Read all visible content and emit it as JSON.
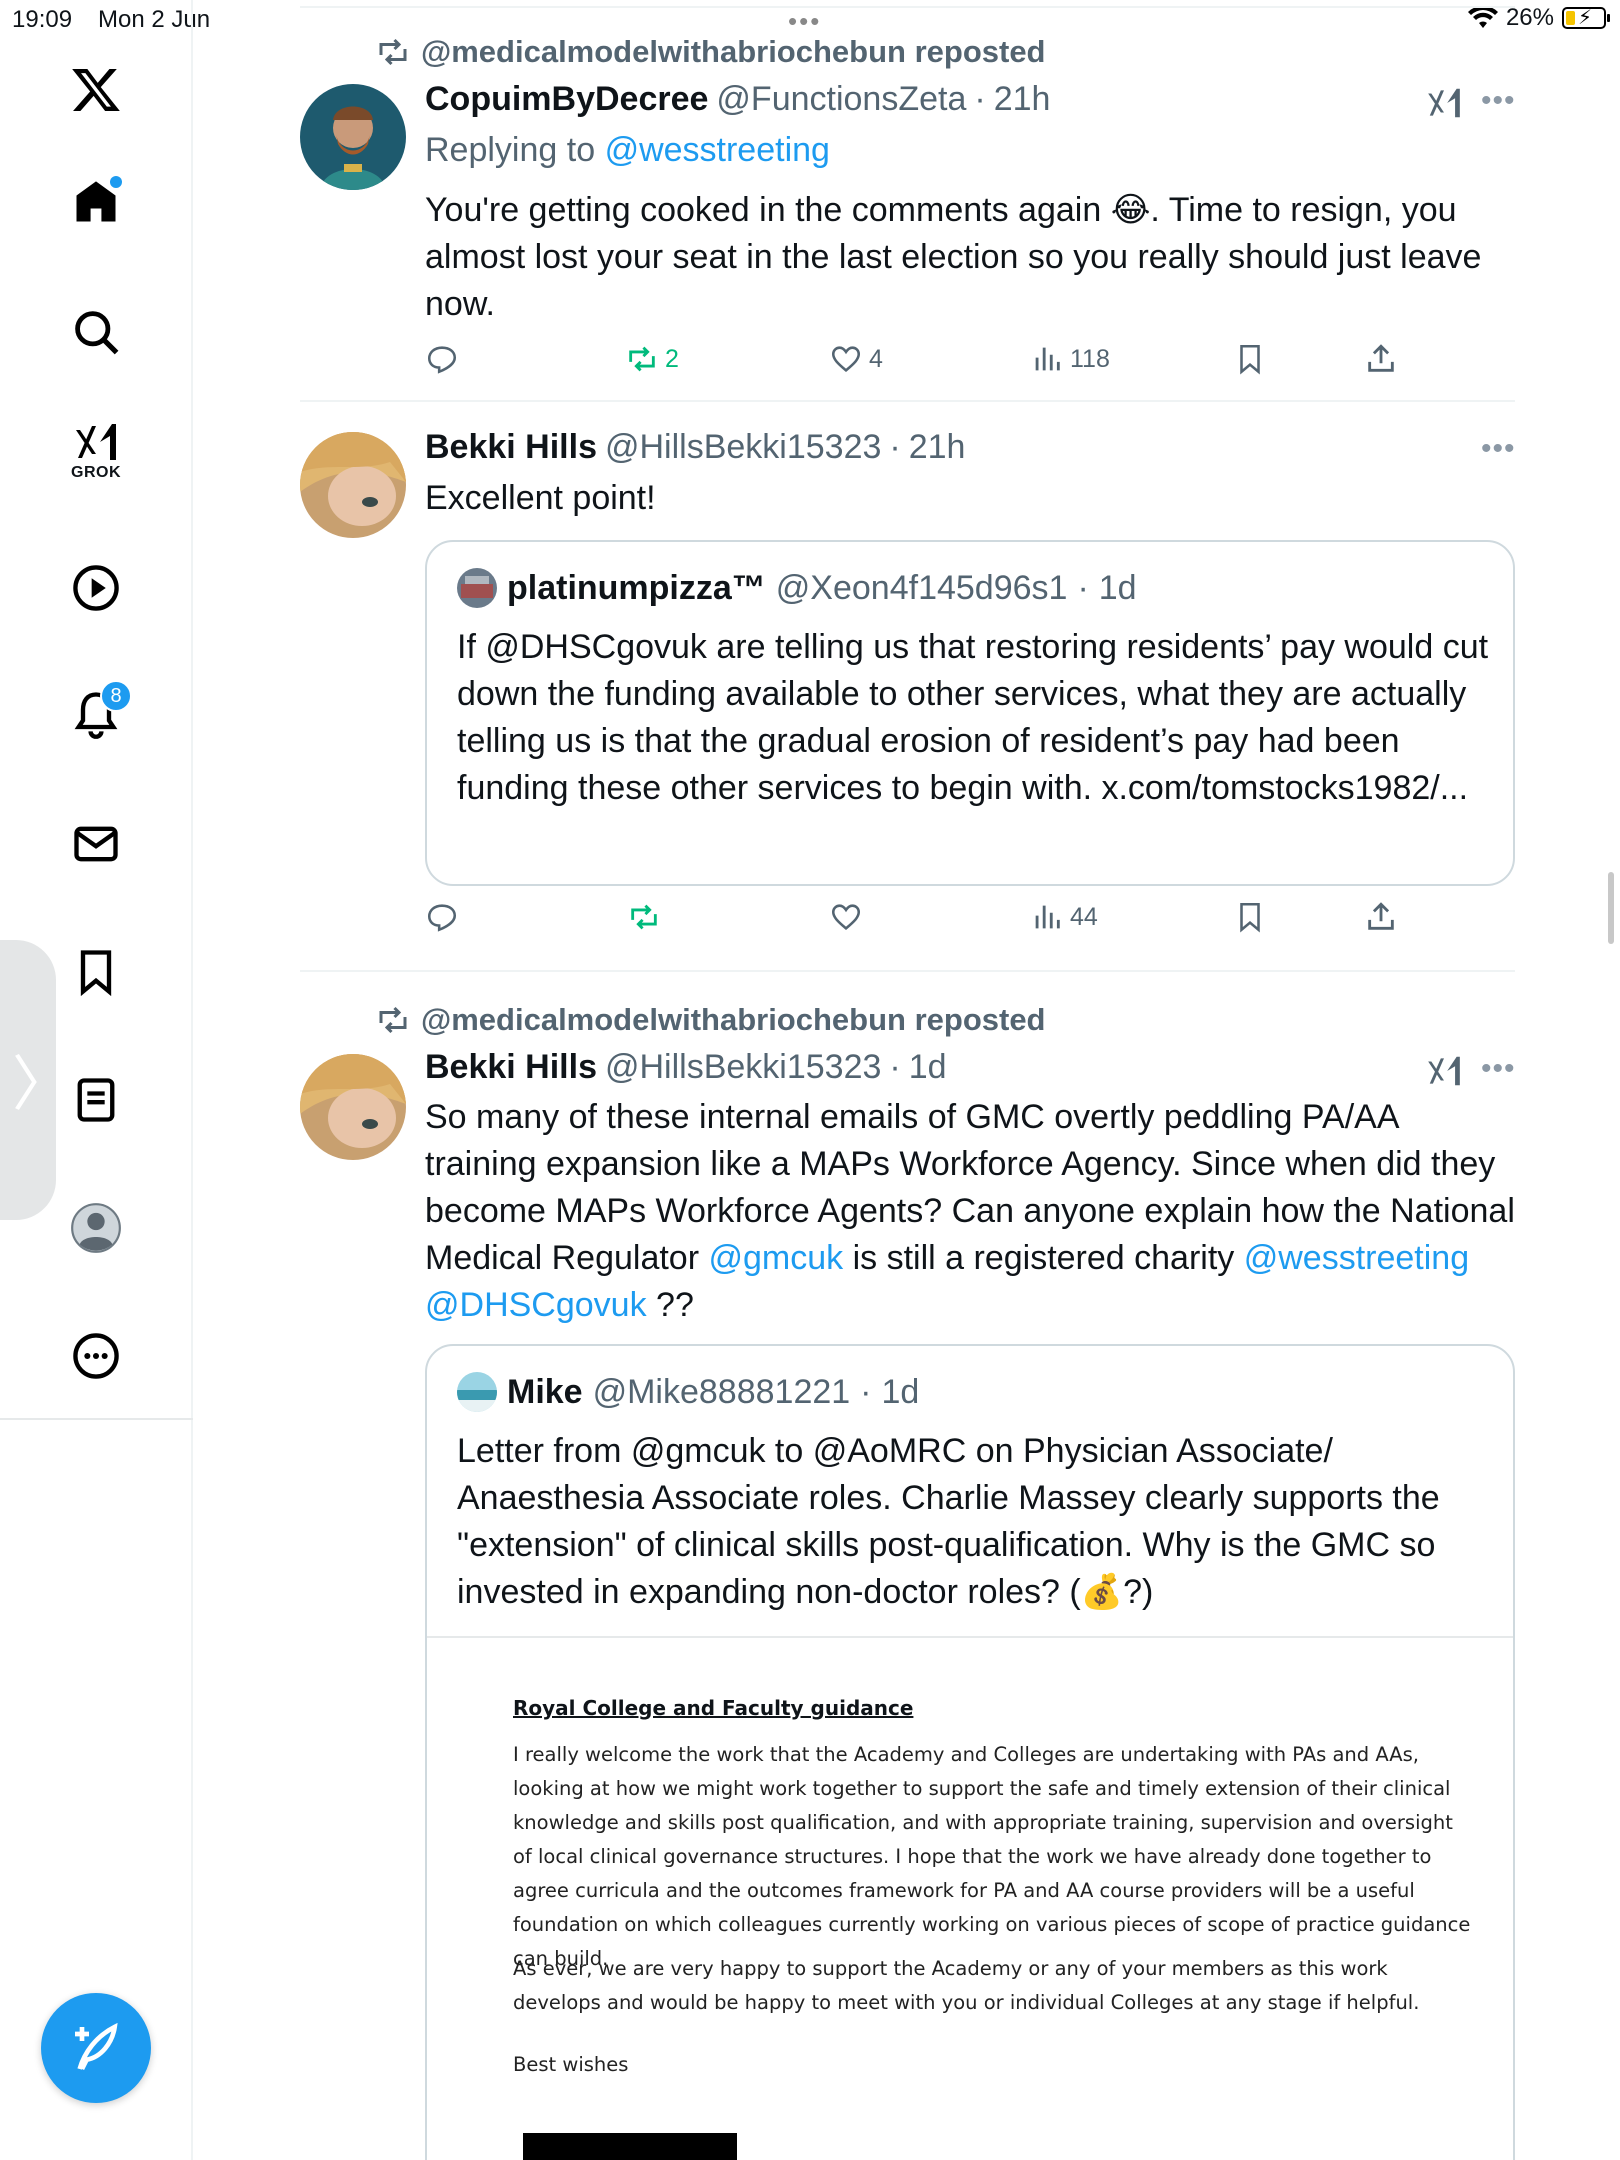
{
  "status_bar": {
    "time": "19:09",
    "date": "Mon 2 Jun",
    "battery": "26%",
    "battery_level": 0.26
  },
  "sidebar": {
    "items": [
      {
        "name": "x-logo",
        "label": ""
      },
      {
        "name": "home",
        "label": ""
      },
      {
        "name": "search",
        "label": ""
      },
      {
        "name": "grok",
        "label": "GROK"
      },
      {
        "name": "videos",
        "label": ""
      },
      {
        "name": "notifications",
        "label": "",
        "badge": "8"
      },
      {
        "name": "messages",
        "label": ""
      },
      {
        "name": "bookmarks",
        "label": ""
      },
      {
        "name": "lists",
        "label": ""
      },
      {
        "name": "profile",
        "label": ""
      },
      {
        "name": "more",
        "label": ""
      }
    ],
    "grok_label": "GROK",
    "notification_badge": "8"
  },
  "tweets": [
    {
      "repost_text": "@medicalmodelwithabriochebun reposted",
      "display_name": "CopuimByDecree",
      "handle": "@FunctionsZeta",
      "dot": "·",
      "time": "21h",
      "replying_prefix": "Replying to",
      "replying_to": "@wesstreeting",
      "text_part1": "You're getting cooked in the comments again ",
      "emoji": "😂",
      "text_part2": ". Time to resign, you almost lost your seat in the last election so you really should just leave now.",
      "retweets": "2",
      "likes": "4",
      "views": "118"
    },
    {
      "display_name": "Bekki Hills",
      "handle": "@HillsBekki15323",
      "dot": "·",
      "time": "21h",
      "text": "Excellent point!",
      "quote": {
        "display_name": "platinumpizza™",
        "handle": "@Xeon4f145d96s1",
        "dot": "·",
        "time": "1d",
        "text": "If @DHSCgovuk are telling us that restoring residents’ pay would cut down the funding available to other services, what they are actually telling us is that the gradual erosion of resident’s pay had been funding these other services to begin with. x.com/tomstocks1982/..."
      },
      "views": "44"
    },
    {
      "repost_text": "@medicalmodelwithabriochebun reposted",
      "display_name": "Bekki Hills",
      "handle": "@HillsBekki15323",
      "dot": "·",
      "time": "1d",
      "text_part1": "So many of these internal emails of GMC overtly peddling PA/AA training expansion like a MAPs Workforce Agency. Since when did they become MAPs Workforce Agents? Can anyone explain how the National Medical Regulator ",
      "mention1": "@gmcuk",
      "text_part2": " is still a registered charity ",
      "mention2": "@wesstreeting",
      "mention3": "@DHSCgovuk",
      "text_part3": " ??",
      "quote": {
        "display_name": "Mike",
        "handle": "@Mike88881221",
        "dot": "·",
        "time": "1d",
        "text_part1": "Letter from @gmcuk to @AoMRC on Physician Associate/ Anaesthesia Associate roles. Charlie Massey clearly supports the \"extension\" of clinical skills post-qualification. Why is the GMC so invested in expanding non-doctor roles? (",
        "emoji": "💰",
        "text_part2": "?)",
        "image": {
          "heading": "Royal College and Faculty guidance",
          "para1": "I really welcome the work that the Academy and Colleges are undertaking with PAs and AAs, looking at how we might work together to support the safe and timely extension of their clinical knowledge and skills post qualification, and with appropriate training, supervision and oversight of local clinical governance structures. I hope that the work we have already done together to agree curricula and the outcomes framework for PA and AA course providers will be a useful foundation on which colleagues currently working on various pieces of scope of practice guidance can build.",
          "para2": "As ever, we are very happy to support the Academy or any of your members as this work develops and would be happy to meet with you or individual Colleges at any stage if helpful.",
          "signoff": "Best wishes"
        }
      }
    }
  ],
  "colors": {
    "accent": "#1d9bf0",
    "secondary_text": "#536471",
    "repost_green": "#00ba7c"
  },
  "icons": [
    "x-logo-icon",
    "home-icon",
    "search-icon",
    "grok-icon",
    "play-icon",
    "bell-icon",
    "mail-icon",
    "bookmark-icon",
    "document-icon",
    "person-icon",
    "more-icon",
    "compose-icon",
    "repost-icon",
    "reply-icon",
    "like-icon",
    "views-icon",
    "share-icon"
  ]
}
